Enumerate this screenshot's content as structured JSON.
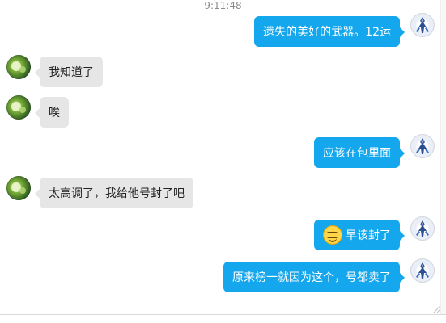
{
  "chat": {
    "timestamp": "9:11:48",
    "messages": [
      {
        "side": "right",
        "text": "遗失的美好的武器。12运"
      },
      {
        "side": "left",
        "text": "我知道了"
      },
      {
        "side": "left",
        "text": "唉"
      },
      {
        "side": "right",
        "text": "应该在包里面"
      },
      {
        "side": "left",
        "text": "太高调了，我给他号封了吧"
      },
      {
        "side": "right",
        "text": "早该封了",
        "emoji": "smiling-face-with-sunglasses-icon"
      },
      {
        "side": "right",
        "text": "原来榜一就因为这个，号都卖了"
      }
    ]
  },
  "colors": {
    "outgoing_bubble": "#14a7ee",
    "incoming_bubble": "#e6e6e6",
    "timestamp_text": "#8c8c8c"
  }
}
